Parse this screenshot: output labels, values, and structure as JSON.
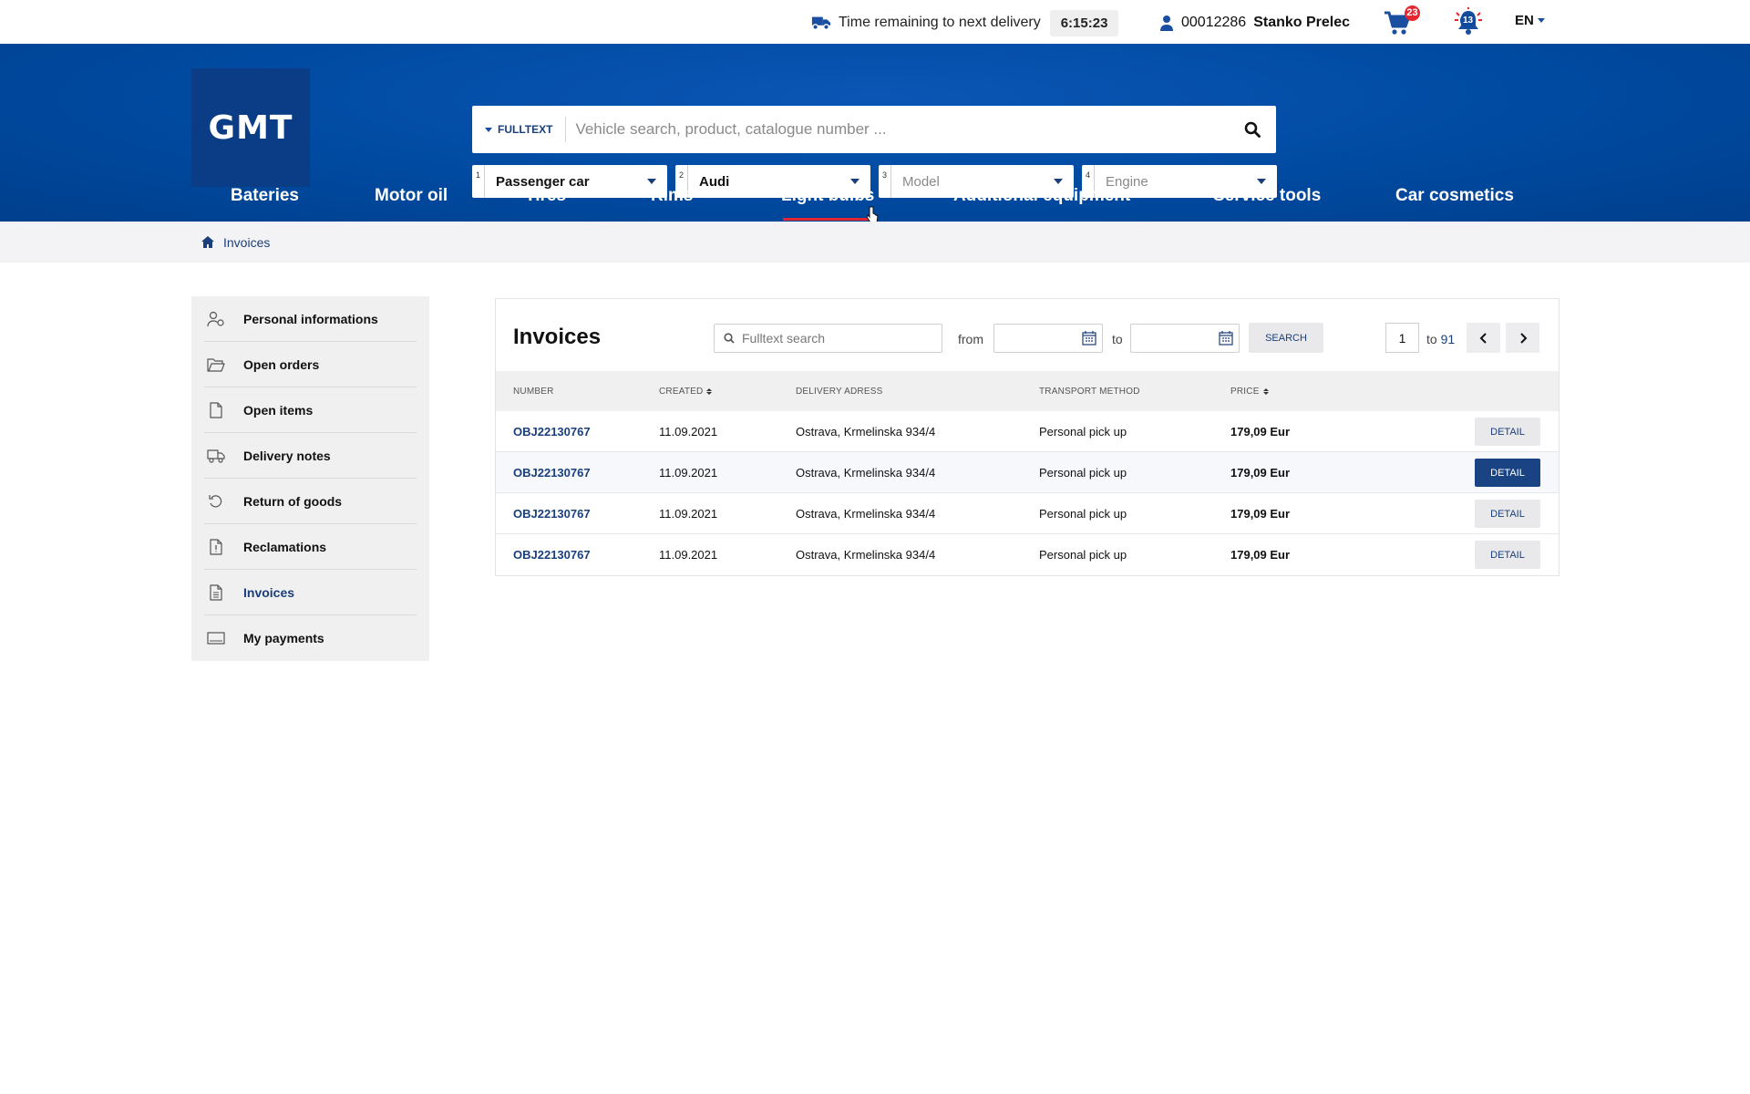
{
  "topbar": {
    "delivery_label": "Time remaining to next delivery",
    "delivery_timer": "6:15:23",
    "user_id": "00012286",
    "user_name": "Stanko Prelec",
    "cart_count": "23",
    "notification_count": "13",
    "language": "EN"
  },
  "header": {
    "logo_text": "GMT",
    "search_mode": "FULLTEXT",
    "search_placeholder": "Vehicle search, product, catalogue number ...",
    "vehicle_selects": [
      {
        "num": "1",
        "value": "Passenger car"
      },
      {
        "num": "2",
        "value": "Audi"
      },
      {
        "num": "3",
        "value": "Model"
      },
      {
        "num": "4",
        "value": "Engine"
      }
    ],
    "categories": [
      "Bateries",
      "Motor oil",
      "Tires",
      "Rims",
      "Light bulbs",
      "Additional equipment",
      "Service tools",
      "Car cosmetics"
    ]
  },
  "breadcrumb": {
    "current": "Invoices"
  },
  "sidebar": {
    "items": [
      {
        "label": "Personal informations",
        "icon": "user-settings-icon"
      },
      {
        "label": "Open orders",
        "icon": "folder-open-icon"
      },
      {
        "label": "Open items",
        "icon": "file-icon"
      },
      {
        "label": "Delivery notes",
        "icon": "truck-icon"
      },
      {
        "label": "Return of goods",
        "icon": "undo-icon"
      },
      {
        "label": "Reclamations",
        "icon": "file-warning-icon"
      },
      {
        "label": "Invoices",
        "icon": "file-text-icon"
      },
      {
        "label": "My payments",
        "icon": "card-icon"
      }
    ],
    "active": "Invoices"
  },
  "invoices": {
    "title": "Invoices",
    "search_placeholder": "Fulltext search",
    "from_label": "from",
    "to_label": "to",
    "search_button": "SEARCH",
    "page_current": "1",
    "page_to_label": "to",
    "page_total": "91",
    "columns": [
      "NUMBER",
      "CREATED",
      "DELIVERY ADRESS",
      "TRANSPORT METHOD",
      "PRICE"
    ],
    "detail_label": "DETAIL",
    "rows": [
      {
        "number": "OBJ22130767",
        "created": "11.09.2021",
        "address": "Ostrava, Krmelinska 934/4",
        "transport": "Personal pick up",
        "price": "179,09 Eur"
      },
      {
        "number": "OBJ22130767",
        "created": "11.09.2021",
        "address": "Ostrava, Krmelinska 934/4",
        "transport": "Personal pick up",
        "price": "179,09 Eur"
      },
      {
        "number": "OBJ22130767",
        "created": "11.09.2021",
        "address": "Ostrava, Krmelinska 934/4",
        "transport": "Personal pick up",
        "price": "179,09 Eur"
      },
      {
        "number": "OBJ22130767",
        "created": "11.09.2021",
        "address": "Ostrava, Krmelinska 934/4",
        "transport": "Personal pick up",
        "price": "179,09 Eur"
      }
    ]
  },
  "colors": {
    "brand_blue": "#004aa1",
    "accent_red": "#e52630",
    "link_blue": "#1a3f7a",
    "dark_button": "#1a4384"
  }
}
